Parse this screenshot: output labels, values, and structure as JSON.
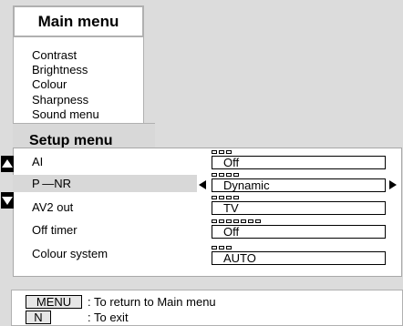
{
  "main_menu": {
    "title": "Main menu",
    "items": [
      "Contrast",
      "Brightness",
      "Colour",
      "Sharpness",
      "Sound menu"
    ]
  },
  "setup_menu": {
    "title": "Setup menu",
    "rows": [
      {
        "label": "AI",
        "value": "Off",
        "dots": 3
      },
      {
        "label": "P —NR",
        "value": "Dynamic",
        "dots": 4,
        "selected": true
      },
      {
        "label": "AV2 out",
        "value": "TV",
        "dots": 4
      },
      {
        "label": "Off timer",
        "value": "Off",
        "dots": 7
      },
      {
        "label": "Colour system",
        "value": "AUTO",
        "dots": 3
      }
    ]
  },
  "help": {
    "items": [
      {
        "key": "MENU",
        "text": ": To return to Main menu"
      },
      {
        "key": "N",
        "text": ": To exit"
      }
    ]
  }
}
